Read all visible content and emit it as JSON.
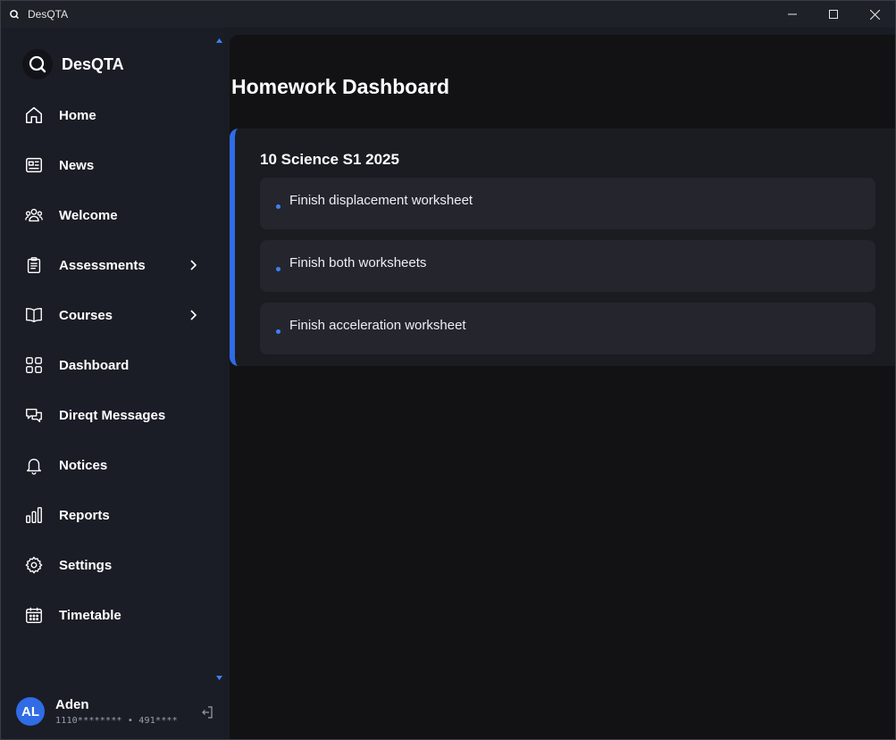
{
  "window": {
    "title": "DesQTA",
    "controls": {
      "minimize": "minimize-icon",
      "maximize": "maximize-icon",
      "close": "close-icon"
    }
  },
  "sidebar": {
    "brand": "DesQTA",
    "items": [
      {
        "label": "Home",
        "icon": "home-icon"
      },
      {
        "label": "News",
        "icon": "newspaper-icon"
      },
      {
        "label": "Welcome",
        "icon": "users-icon"
      },
      {
        "label": "Assessments",
        "icon": "clipboard-icon",
        "expandable": true
      },
      {
        "label": "Courses",
        "icon": "book-icon",
        "expandable": true
      },
      {
        "label": "Dashboard",
        "icon": "grid-icon"
      },
      {
        "label": "Direqt Messages",
        "icon": "chat-icon"
      },
      {
        "label": "Notices",
        "icon": "bell-icon"
      },
      {
        "label": "Reports",
        "icon": "bar-chart-icon"
      },
      {
        "label": "Settings",
        "icon": "gear-icon"
      },
      {
        "label": "Timetable",
        "icon": "calendar-icon"
      }
    ]
  },
  "user": {
    "initials": "AL",
    "name": "Aden",
    "id_text": "1110******** • 491****"
  },
  "main": {
    "title": "Homework Dashboard",
    "courses": [
      {
        "title": "10 Science S1 2025",
        "tasks": [
          "Finish displacement worksheet",
          "Finish both worksheets",
          "Finish acceleration worksheet"
        ]
      }
    ]
  },
  "colors": {
    "accent": "#2f6ce6",
    "dot": "#3b82f6",
    "sidebar_bg": "#1b1d26",
    "main_bg": "#121214",
    "card_bg": "#1b1c22",
    "task_bg": "#25262d"
  }
}
